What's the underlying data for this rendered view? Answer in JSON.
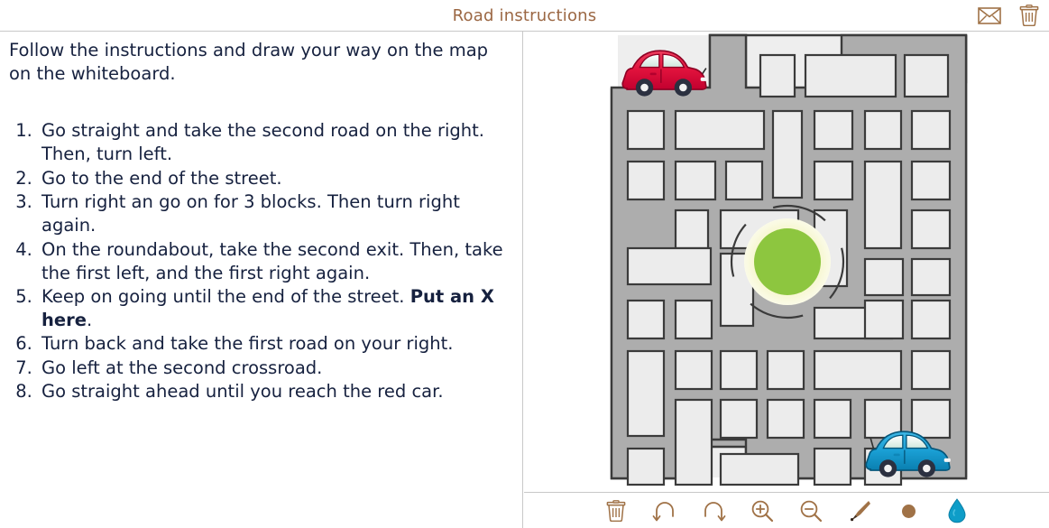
{
  "header": {
    "title": "Road instructions",
    "icons": [
      {
        "name": "mail-icon",
        "label": "Send by e-mail"
      },
      {
        "name": "trash-icon",
        "label": "Delete"
      }
    ]
  },
  "left_panel": {
    "intro": "Follow the instructions and draw your way on the map on the whiteboard.",
    "instructions": [
      {
        "number": "1.",
        "text": "Go straight and take the second road on the right. Then, turn left."
      },
      {
        "number": "2.",
        "text": "Go to the end of the street."
      },
      {
        "number": "3.",
        "text": "Turn right an go on for 3 blocks. Then turn right again."
      },
      {
        "number": "4.",
        "text": "On the roundabout, take the second exit. Then, take the first left, and the first right again."
      },
      {
        "number": "5.",
        "text": "Keep on going until the end of the street. ",
        "bold": "Put an X here",
        "tail": "."
      },
      {
        "number": "6.",
        "text": "Turn back and take the first road on your right."
      },
      {
        "number": "7.",
        "text": "Go left at the second crossroad."
      },
      {
        "number": "8.",
        "text": "Go straight ahead until you reach the red car."
      }
    ]
  },
  "whiteboard": {
    "map": {
      "road_color": "#adadad",
      "block_fill": "#ececec",
      "block_stroke": "#3b3b3b",
      "shadow_color": "#eeeeee",
      "roundabout_center_color": "#8dc63f",
      "roundabout_ring_color": "#f4f4c4",
      "cars": [
        {
          "name": "red-car",
          "color": "#e0123c",
          "position": "top-left"
        },
        {
          "name": "blue-car",
          "color": "#1a9fd4",
          "position": "bottom-right"
        }
      ]
    }
  },
  "toolbar": {
    "buttons": [
      {
        "name": "clear-button",
        "label": "Clear"
      },
      {
        "name": "undo-button",
        "label": "Undo"
      },
      {
        "name": "redo-button",
        "label": "Redo"
      },
      {
        "name": "zoom-in-button",
        "label": "Zoom in"
      },
      {
        "name": "zoom-out-button",
        "label": "Zoom out"
      },
      {
        "name": "brush-button",
        "label": "Brush"
      },
      {
        "name": "brush-size-button",
        "label": "Brush size"
      },
      {
        "name": "color-button",
        "label": "Colour"
      }
    ],
    "icon_color": "#a07247",
    "color_swatch": "#0e9dc8"
  }
}
